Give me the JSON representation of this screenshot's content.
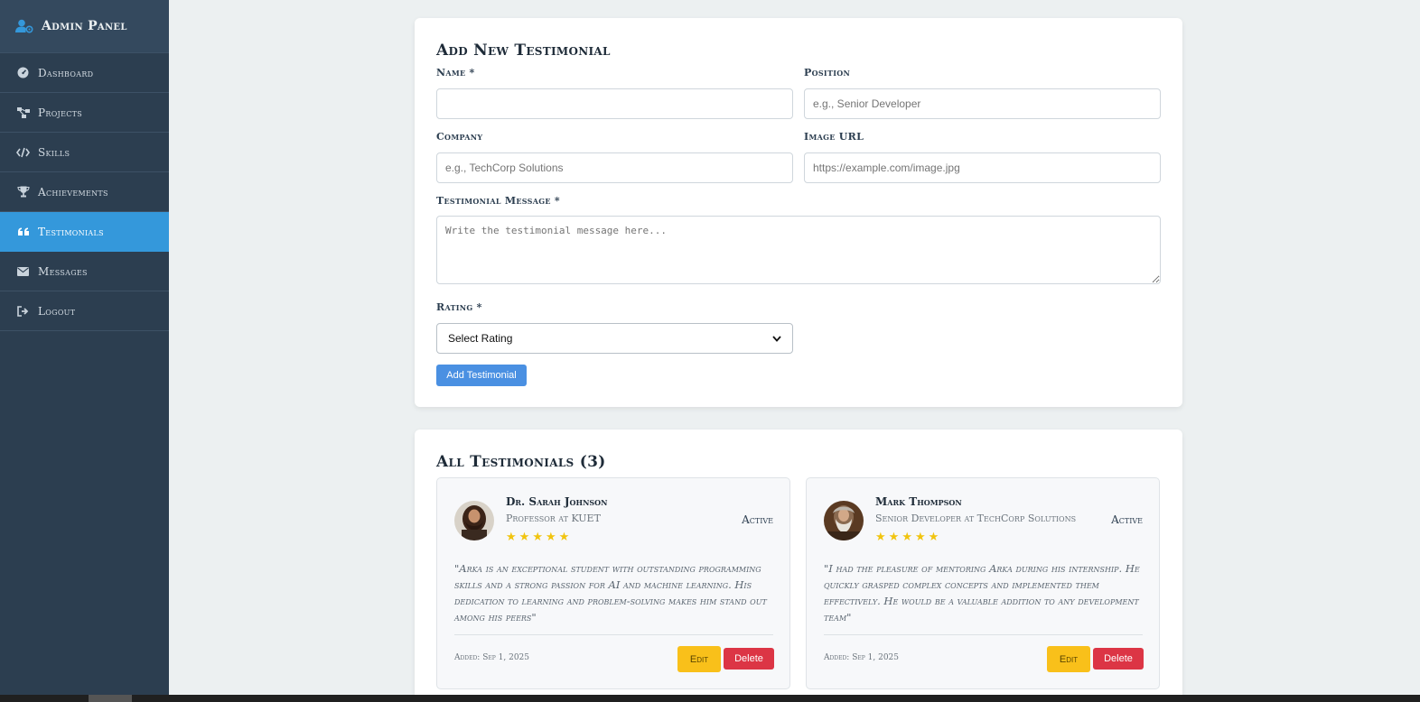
{
  "sidebar": {
    "brand": {
      "title": "Admin Panel",
      "icon": "user-gear-icon"
    },
    "items": [
      {
        "label": "Dashboard",
        "icon": "gauge-icon",
        "active": false
      },
      {
        "label": "Projects",
        "icon": "project-diagram-icon",
        "active": false
      },
      {
        "label": "Skills",
        "icon": "code-icon",
        "active": false
      },
      {
        "label": "Achievements",
        "icon": "trophy-icon",
        "active": false
      },
      {
        "label": "Testimonials",
        "icon": "quote-icon",
        "active": true
      },
      {
        "label": "Messages",
        "icon": "envelope-icon",
        "active": false
      },
      {
        "label": "Logout",
        "icon": "sign-out-icon",
        "active": false
      }
    ]
  },
  "form": {
    "title": "Add New Testimonial",
    "name": {
      "label": "Name *",
      "value": "",
      "placeholder": ""
    },
    "position": {
      "label": "Position",
      "value": "",
      "placeholder": "e.g., Senior Developer"
    },
    "company": {
      "label": "Company",
      "value": "",
      "placeholder": "e.g., TechCorp Solutions"
    },
    "image_url": {
      "label": "Image URL",
      "value": "",
      "placeholder": "https://example.com/image.jpg"
    },
    "message": {
      "label": "Testimonial Message *",
      "value": "",
      "placeholder": "Write the testimonial message here..."
    },
    "rating": {
      "label": "Rating *",
      "selected": "Select Rating"
    },
    "submit_label": "Add Testimonial"
  },
  "list": {
    "title": "All Testimonials (3)",
    "items": [
      {
        "name": "Dr. Sarah Johnson",
        "position": "Professor at KUET",
        "status": "Active",
        "rating": 5,
        "message": "\"Arka is an exceptional student with outstanding programming skills and a strong passion for AI and machine learning. His dedication to learning and problem-solving makes him stand out among his peers\"",
        "date": "Added: Sep 1, 2025",
        "edit_label": "Edit",
        "delete_label": "Delete"
      },
      {
        "name": "Mark Thompson",
        "position": "Senior Developer at TechCorp Solutions",
        "status": "Active",
        "rating": 5,
        "message": "\"I had the pleasure of mentoring Arka during his internship. He quickly grasped complex concepts and implemented them effectively. He would be a valuable addition to any development team\"",
        "date": "Added: Sep 1, 2025",
        "edit_label": "Edit",
        "delete_label": "Delete"
      }
    ]
  },
  "colors": {
    "sidebar_bg": "#2c3e50",
    "active_nav": "#3498db",
    "primary_button": "#4a90e2",
    "edit_button": "#f9c01a",
    "delete_button": "#dc3545",
    "star": "#f1c40f"
  }
}
